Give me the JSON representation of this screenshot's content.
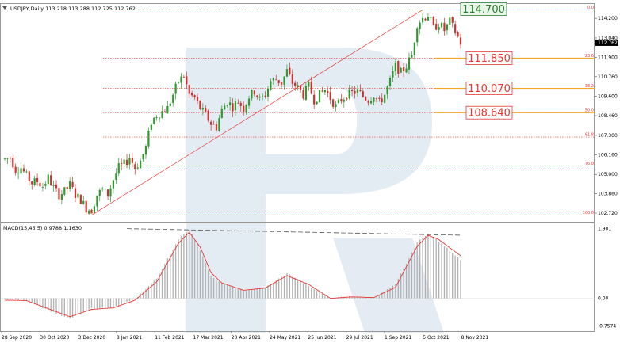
{
  "chart_data": {
    "type": "candlestick",
    "title": "USDJPY,Daily",
    "ohlc_readout": "113.218 113.288 112.725 112.762",
    "current_price_label": "112.762",
    "colors": {
      "bull": "#2e9b2e",
      "bear": "#d32f2f",
      "fib": "#e53935",
      "fib_box": "#f5a623",
      "top_box": "#2e7d32",
      "macd_hist": "#b0b0b0",
      "macd_signal": "#e53935",
      "trend": "#e53935",
      "divergence": "#555555"
    },
    "price_axis": {
      "min": 102.3,
      "max": 115.0,
      "ticks": [
        "114.200",
        "113.040",
        "111.900",
        "110.760",
        "109.600",
        "108.460",
        "107.300",
        "106.160",
        "105.000",
        "103.860",
        "102.720"
      ]
    },
    "x_ticks": [
      "28 Sep 2020",
      "30 Oct 2020",
      "3 Dec 2020",
      "8 Jan 2021",
      "11 Feb 2021",
      "17 Mar 2021",
      "20 Apr 2021",
      "24 May 2021",
      "25 Jun 2021",
      "29 Jul 2021",
      "1 Sep 2021",
      "5 Oct 2021",
      "8 Nov 2021"
    ],
    "fib_levels": [
      {
        "pct": "0.0",
        "price": 114.7
      },
      {
        "pct": "23.6",
        "price": 111.85
      },
      {
        "pct": "38.2",
        "price": 110.07
      },
      {
        "pct": "50.0",
        "price": 108.64
      },
      {
        "pct": "61.8",
        "price": 107.2
      },
      {
        "pct": "76.0",
        "price": 105.5
      },
      {
        "pct": "100.0",
        "price": 102.6
      }
    ],
    "level_boxes": [
      {
        "label": "114.700",
        "price": 114.7,
        "style": "top"
      },
      {
        "label": "111.850",
        "price": 111.85,
        "style": "fib"
      },
      {
        "label": "110.070",
        "price": 110.07,
        "style": "fib"
      },
      {
        "label": "108.640",
        "price": 108.64,
        "style": "fib"
      }
    ],
    "trendline": {
      "from": [
        "8 Jan 2021",
        102.6
      ],
      "to": [
        "5 Oct 2021",
        114.7
      ]
    },
    "price_path": [
      [
        0,
        105.9
      ],
      [
        4,
        106.0
      ],
      [
        8,
        105.3
      ],
      [
        12,
        105.4
      ],
      [
        16,
        104.9
      ],
      [
        20,
        104.5
      ],
      [
        24,
        104.6
      ],
      [
        28,
        104.3
      ],
      [
        32,
        104.8
      ],
      [
        36,
        104.2
      ],
      [
        40,
        103.8
      ],
      [
        44,
        104.0
      ],
      [
        48,
        104.4
      ],
      [
        52,
        103.8
      ],
      [
        56,
        103.5
      ],
      [
        60,
        103.0
      ],
      [
        64,
        102.9
      ],
      [
        68,
        103.8
      ],
      [
        72,
        104.1
      ],
      [
        76,
        103.8
      ],
      [
        80,
        104.7
      ],
      [
        84,
        105.4
      ],
      [
        88,
        105.6
      ],
      [
        92,
        106.0
      ],
      [
        96,
        105.4
      ],
      [
        100,
        105.8
      ],
      [
        104,
        106.6
      ],
      [
        108,
        108.1
      ],
      [
        112,
        108.5
      ],
      [
        116,
        108.7
      ],
      [
        120,
        108.9
      ],
      [
        124,
        109.7
      ],
      [
        128,
        110.5
      ],
      [
        132,
        110.8
      ],
      [
        136,
        109.7
      ],
      [
        140,
        109.5
      ],
      [
        144,
        108.9
      ],
      [
        148,
        108.5
      ],
      [
        152,
        108.0
      ],
      [
        156,
        107.8
      ],
      [
        160,
        108.8
      ],
      [
        164,
        109.3
      ],
      [
        168,
        109.0
      ],
      [
        172,
        109.3
      ],
      [
        176,
        108.9
      ],
      [
        180,
        109.6
      ],
      [
        184,
        109.9
      ],
      [
        188,
        109.4
      ],
      [
        192,
        109.7
      ],
      [
        196,
        110.5
      ],
      [
        200,
        110.6
      ],
      [
        204,
        110.4
      ],
      [
        208,
        111.1
      ],
      [
        212,
        110.4
      ],
      [
        216,
        110.1
      ],
      [
        220,
        109.7
      ],
      [
        224,
        110.2
      ],
      [
        228,
        109.4
      ],
      [
        232,
        109.7
      ],
      [
        236,
        110.0
      ],
      [
        240,
        109.5
      ],
      [
        244,
        109.0
      ],
      [
        248,
        109.4
      ],
      [
        252,
        109.7
      ],
      [
        256,
        109.8
      ],
      [
        260,
        109.9
      ],
      [
        264,
        109.6
      ],
      [
        268,
        109.4
      ],
      [
        272,
        109.7
      ],
      [
        276,
        109.2
      ],
      [
        280,
        109.7
      ],
      [
        284,
        110.5
      ],
      [
        288,
        111.4
      ],
      [
        292,
        111.0
      ],
      [
        296,
        111.4
      ],
      [
        300,
        112.0
      ],
      [
        304,
        113.9
      ],
      [
        308,
        114.2
      ],
      [
        312,
        114.4
      ],
      [
        316,
        113.6
      ],
      [
        320,
        113.9
      ],
      [
        324,
        113.5
      ],
      [
        328,
        114.0
      ],
      [
        332,
        113.4
      ],
      [
        336,
        112.76
      ]
    ],
    "macd": {
      "label": "MACD(15,45,5) 0.9788 1.1630",
      "axis": {
        "min": -0.85,
        "max": 2.0,
        "ticks": [
          "1.901",
          "0.00",
          "-0.7574"
        ]
      },
      "hist": [
        [
          0,
          -0.04
        ],
        [
          16,
          -0.05
        ],
        [
          32,
          -0.33
        ],
        [
          48,
          -0.55
        ],
        [
          64,
          -0.28
        ],
        [
          80,
          -0.25
        ],
        [
          96,
          -0.02
        ],
        [
          112,
          0.55
        ],
        [
          128,
          1.62
        ],
        [
          136,
          1.88
        ],
        [
          144,
          1.3
        ],
        [
          152,
          0.6
        ],
        [
          160,
          0.4
        ],
        [
          176,
          0.22
        ],
        [
          192,
          0.3
        ],
        [
          208,
          0.68
        ],
        [
          224,
          0.35
        ],
        [
          240,
          0.0
        ],
        [
          256,
          0.05
        ],
        [
          272,
          0.0
        ],
        [
          288,
          0.38
        ],
        [
          304,
          1.52
        ],
        [
          312,
          1.78
        ],
        [
          320,
          1.55
        ],
        [
          336,
          1.06
        ]
      ],
      "signal": [
        [
          0,
          -0.05
        ],
        [
          16,
          -0.06
        ],
        [
          32,
          -0.28
        ],
        [
          48,
          -0.5
        ],
        [
          64,
          -0.3
        ],
        [
          80,
          -0.26
        ],
        [
          96,
          -0.05
        ],
        [
          112,
          0.45
        ],
        [
          128,
          1.5
        ],
        [
          136,
          1.8
        ],
        [
          144,
          1.4
        ],
        [
          152,
          0.7
        ],
        [
          160,
          0.42
        ],
        [
          176,
          0.22
        ],
        [
          192,
          0.28
        ],
        [
          208,
          0.62
        ],
        [
          224,
          0.38
        ],
        [
          240,
          0.0
        ],
        [
          256,
          0.04
        ],
        [
          272,
          0.02
        ],
        [
          288,
          0.3
        ],
        [
          304,
          1.42
        ],
        [
          312,
          1.72
        ],
        [
          320,
          1.6
        ],
        [
          336,
          1.16
        ]
      ],
      "divergence": {
        "from": [
          90,
          1.9
        ],
        "to": [
          336,
          1.72
        ]
      }
    }
  }
}
